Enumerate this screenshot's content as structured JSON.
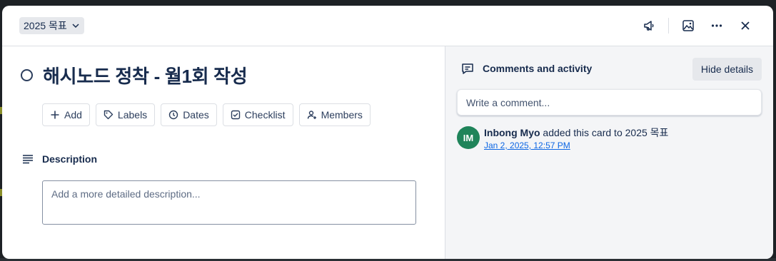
{
  "header": {
    "list_name": "2025 목표"
  },
  "card": {
    "title": "해시노드 정착 - 월1회 작성"
  },
  "actions": [
    {
      "label": "Add",
      "icon": "plus-icon"
    },
    {
      "label": "Labels",
      "icon": "label-tag-icon"
    },
    {
      "label": "Dates",
      "icon": "clock-icon"
    },
    {
      "label": "Checklist",
      "icon": "checklist-icon"
    },
    {
      "label": "Members",
      "icon": "add-member-icon"
    }
  ],
  "description": {
    "heading": "Description",
    "placeholder": "Add a more detailed description..."
  },
  "sidebar": {
    "heading": "Comments and activity",
    "hide_details_label": "Hide details",
    "comment_placeholder": "Write a comment...",
    "activity": {
      "avatar_initials": "IM",
      "user": "Inbong Myo",
      "text": " added this card to 2025 목표",
      "timestamp": "Jan 2, 2025, 12:57 PM"
    }
  },
  "colors": {
    "avatar": "#1f845a",
    "link": "#0c66e4",
    "text": "#172b4d"
  }
}
